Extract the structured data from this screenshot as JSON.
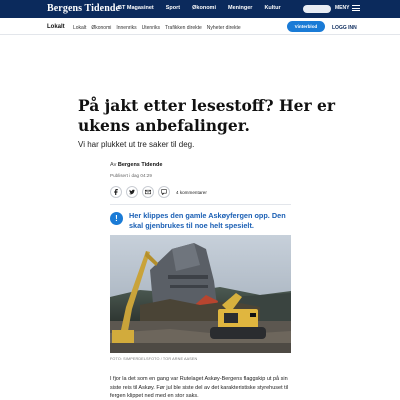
{
  "header": {
    "brand": "Bergens Tidende",
    "nav": [
      "BT Magasinet",
      "Sport",
      "Økonomi",
      "Meninger",
      "Kultur"
    ],
    "menu_label": "MENY"
  },
  "subheader": {
    "section": "Lokalt",
    "nav": [
      "Lokalt",
      "Økonomi",
      "Innenriks",
      "Utenriks",
      "Trafikken direkte",
      "Nyheter direkte"
    ],
    "vote_label": "Vinterblod",
    "login_label": "LOGG INN"
  },
  "article": {
    "headline": "På jakt etter lesestoff? Her er ukens anbefalinger.",
    "lead": "Vi har plukket ut tre saker til deg.",
    "byline_prefix": "Av",
    "byline_author": "Bergens Tidende",
    "published": "Publisert i dag 04:29",
    "comments": "4 kommentarer",
    "fact_badge": "!",
    "fact_text": "Her klippes den gamle Askøyfergen opp. Den skal gjenbrukes til noe helt spesielt.",
    "photo_credit": "FOTO: SIMPERDELSFOTO / TOR ARNE AASEN",
    "body": "I fjor la det som en gang var Rutelaget Askøy-Bergens flaggskip ut på sin siste reis til Askøy. Før jul ble siste del av det karakteristiske styrehuset til fergen klippet ned med en stor saks."
  },
  "icons": {
    "share": [
      "facebook-icon",
      "twitter-icon",
      "mail-icon",
      "comment-icon"
    ],
    "menu": "hamburger-icon"
  },
  "colors": {
    "brand_navy": "#0b2a5c",
    "accent_blue": "#1a7bd6",
    "fact_text_blue": "#1a5fb4"
  }
}
